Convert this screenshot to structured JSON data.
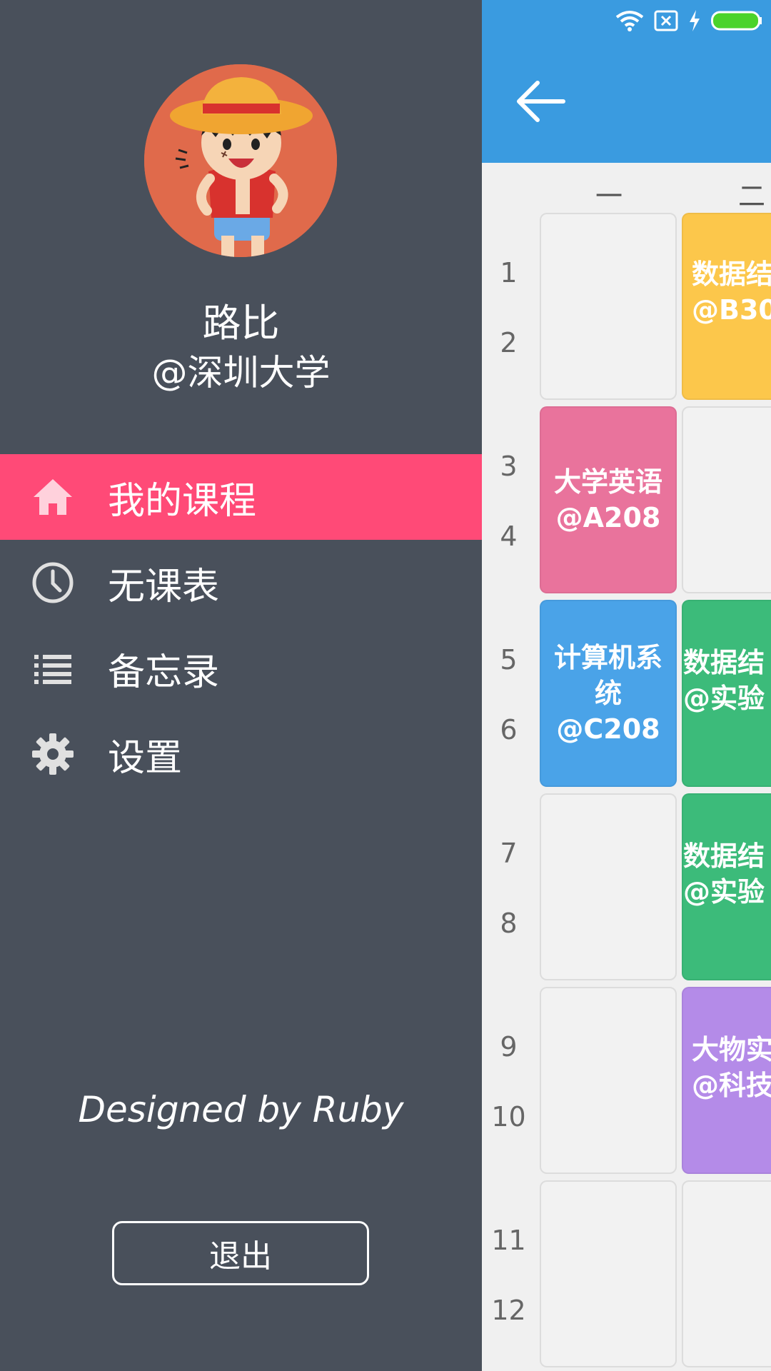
{
  "drawer": {
    "user_name": "路比",
    "user_school": "@深圳大学",
    "nav_items": [
      {
        "label": "我的课程",
        "icon": "home-icon",
        "active": true
      },
      {
        "label": "无课表",
        "icon": "clock-icon",
        "active": false
      },
      {
        "label": "备忘录",
        "icon": "list-icon",
        "active": false
      },
      {
        "label": "设置",
        "icon": "gear-icon",
        "active": false
      }
    ],
    "credit": "Designed by Ruby",
    "logout_label": "退出"
  },
  "schedule": {
    "days": [
      "一",
      "二"
    ],
    "periods": [
      "1",
      "2",
      "3",
      "4",
      "5",
      "6",
      "7",
      "8",
      "9",
      "10",
      "11",
      "12"
    ],
    "courses": [
      {
        "text": "大学英语\n@A208",
        "color": "#e9739c"
      },
      {
        "text": "计算机系\n统\n@C208",
        "color": "#4aa3e8"
      },
      {
        "text": "数据结\n@B30",
        "color": "#fcc74b"
      },
      {
        "text": "数据结\n@实验",
        "color": "#3cbb7a"
      },
      {
        "text": "数据结\n@实验",
        "color": "#3cbb7a"
      },
      {
        "text": "大物实\n@科技",
        "color": "#b48be8"
      }
    ]
  },
  "colors": {
    "drawer_bg": "#49505b",
    "accent_pink": "#ff4a77",
    "appbar_blue": "#3a9be0"
  }
}
